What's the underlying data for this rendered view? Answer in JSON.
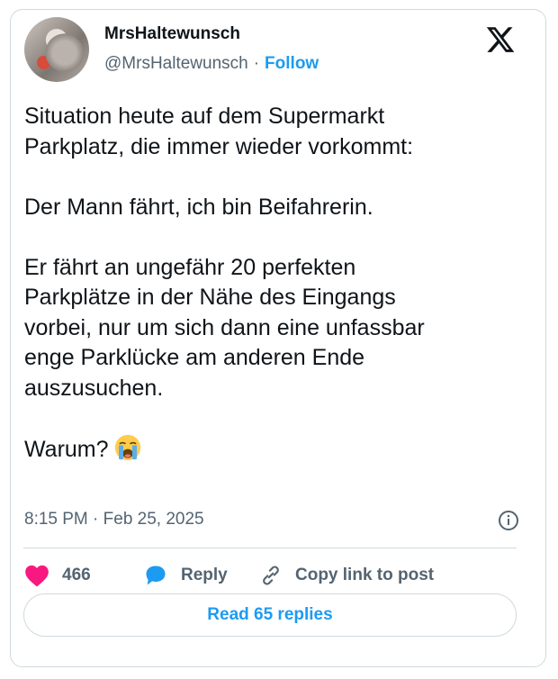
{
  "author": {
    "name": "MrsHaltewunsch",
    "handle": "@MrsHaltewunsch",
    "separator": "·",
    "follow_label": "Follow"
  },
  "tweet": {
    "text": "Situation heute auf dem Supermarkt\nParkplatz, die immer wieder vorkommt:\n\nDer Mann fährt, ich bin Beifahrerin.\n\nEr fährt an ungefähr 20 perfekten\nParkplätze in der Nähe des Eingangs\nvorbei, nur um sich dann eine unfassbar\nenge Parklücke am anderen Ende\nauszusuchen.\n\nWarum? ",
    "emoji": "crying-face-emoji",
    "timestamp": "8:15 PM · Feb 25, 2025"
  },
  "actions": {
    "like_count": "466",
    "reply_label": "Reply",
    "copy_label": "Copy link to post"
  },
  "footer": {
    "read_replies_label": "Read 65 replies"
  },
  "colors": {
    "accent": "#1d9bf0",
    "heart": "#f91880",
    "muted": "#536471",
    "border": "#cfd9de"
  }
}
